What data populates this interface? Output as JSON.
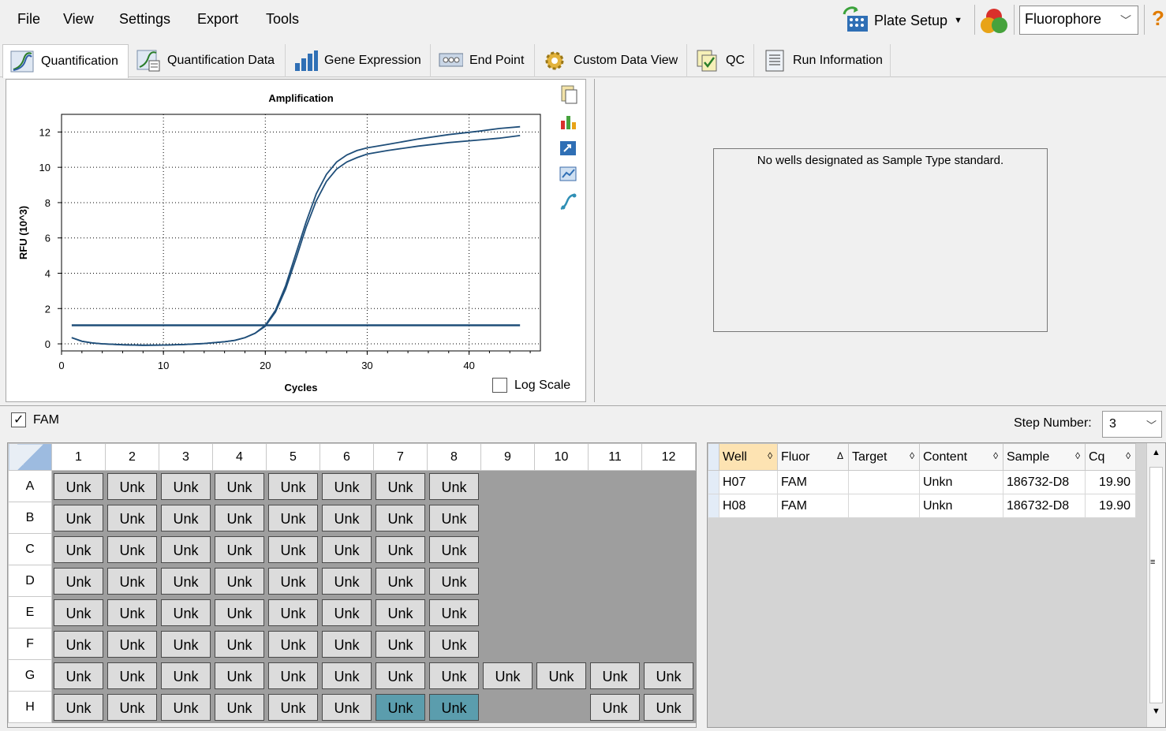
{
  "menu": [
    "File",
    "View",
    "Settings",
    "Export",
    "Tools"
  ],
  "toolbar": {
    "plate_setup": "Plate Setup",
    "fluorophore": "Fluorophore",
    "help": "?"
  },
  "tabs": [
    {
      "label": "Quantification",
      "icon": "amplification-icon"
    },
    {
      "label": "Quantification Data",
      "icon": "amplification-data-icon"
    },
    {
      "label": "Gene Expression",
      "icon": "bar-chart-icon"
    },
    {
      "label": "End Point",
      "icon": "end-point-icon"
    },
    {
      "label": "Custom Data View",
      "icon": "gear-icon"
    },
    {
      "label": "QC",
      "icon": "qc-icon"
    },
    {
      "label": "Run Information",
      "icon": "document-icon"
    }
  ],
  "chart": {
    "log_scale_label": "Log Scale",
    "tools": [
      "copy-icon",
      "chart-settings-icon",
      "export-icon",
      "zoom-icon",
      "curve-icon"
    ]
  },
  "chart_data": {
    "type": "line",
    "title": "Amplification",
    "xlabel": "Cycles",
    "ylabel": "RFU (10^3)",
    "xlim": [
      0,
      47
    ],
    "ylim": [
      -0.4,
      13
    ],
    "xticks": [
      0,
      10,
      20,
      30,
      40
    ],
    "yticks": [
      0,
      2,
      4,
      6,
      8,
      10,
      12
    ],
    "grid": true,
    "series": [
      {
        "color": "#1f4e79",
        "x": [
          1,
          2,
          3,
          4,
          6,
          8,
          10,
          12,
          14,
          16,
          17,
          18,
          19,
          20,
          21,
          22,
          23,
          24,
          25,
          26,
          27,
          28,
          29,
          30,
          32,
          35,
          38,
          41,
          43,
          45
        ],
        "y": [
          0.35,
          0.15,
          0.05,
          0.0,
          -0.05,
          -0.08,
          -0.07,
          -0.04,
          0.02,
          0.12,
          0.2,
          0.35,
          0.6,
          1.0,
          1.8,
          3.1,
          4.8,
          6.6,
          8.1,
          9.2,
          9.9,
          10.3,
          10.55,
          10.75,
          10.95,
          11.2,
          11.4,
          11.55,
          11.65,
          11.8
        ]
      },
      {
        "color": "#1f4e79",
        "x": [
          1,
          2,
          3,
          4,
          6,
          8,
          10,
          12,
          14,
          16,
          17,
          18,
          19,
          20,
          21,
          22,
          23,
          24,
          25,
          26,
          27,
          28,
          29,
          30,
          32,
          35,
          38,
          41,
          43,
          45
        ],
        "y": [
          0.35,
          0.15,
          0.05,
          0.0,
          -0.05,
          -0.08,
          -0.07,
          -0.04,
          0.02,
          0.12,
          0.2,
          0.35,
          0.6,
          1.05,
          1.9,
          3.3,
          5.1,
          6.9,
          8.5,
          9.6,
          10.3,
          10.7,
          10.95,
          11.1,
          11.3,
          11.6,
          11.85,
          12.05,
          12.2,
          12.3
        ]
      }
    ],
    "threshold": {
      "y": 1.05,
      "x": [
        1,
        45
      ],
      "color": "#1f4e79"
    }
  },
  "standard_message": "No wells designated as Sample Type standard.",
  "fam": {
    "label": "FAM",
    "checked": true
  },
  "step": {
    "label": "Step Number:",
    "value": "3"
  },
  "plate": {
    "columns": [
      "1",
      "2",
      "3",
      "4",
      "5",
      "6",
      "7",
      "8",
      "9",
      "10",
      "11",
      "12"
    ],
    "rows": [
      "A",
      "B",
      "C",
      "D",
      "E",
      "F",
      "G",
      "H"
    ],
    "well_label": "Unk",
    "layout": [
      "FFFFFFFF....",
      "FFFFFFFF....",
      "FFFFFFFF....",
      "FFFFFFFF....",
      "FFFFFFFF....",
      "FFFFFFFF....",
      "FFFFFFFFFFFF",
      "FFFFFFSS..FF"
    ]
  },
  "results": {
    "columns": [
      {
        "label": "Well",
        "sort": "◊"
      },
      {
        "label": "Fluor",
        "sort": "Δ"
      },
      {
        "label": "Target",
        "sort": "◊"
      },
      {
        "label": "Content",
        "sort": "◊"
      },
      {
        "label": "Sample",
        "sort": "◊"
      },
      {
        "label": "Cq",
        "sort": "◊"
      }
    ],
    "rows": [
      {
        "well": "H07",
        "fluor": "FAM",
        "target": "",
        "content": "Unkn",
        "sample": "186732-D8",
        "cq": "19.90"
      },
      {
        "well": "H08",
        "fluor": "FAM",
        "target": "",
        "content": "Unkn",
        "sample": "186732-D8",
        "cq": "19.90"
      }
    ]
  }
}
